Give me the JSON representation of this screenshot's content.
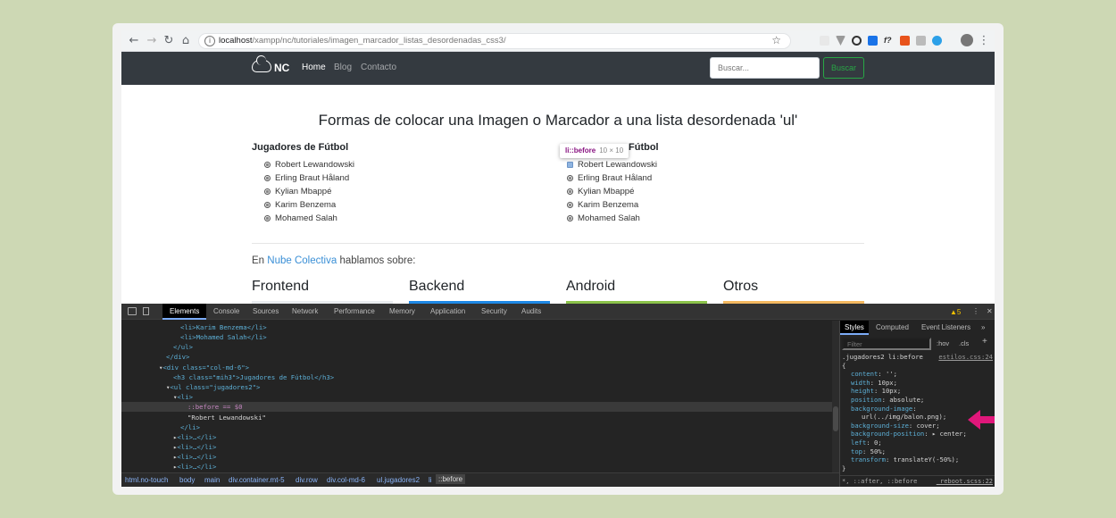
{
  "browser": {
    "url_host": "localhost",
    "url_path": "/xampp/nc/tutoriales/imagen_marcador_listas_desordenadas_css3/"
  },
  "navbar": {
    "brand": "NC",
    "links": [
      "Home",
      "Blog",
      "Contacto"
    ],
    "search_placeholder": "Buscar...",
    "search_button": "Buscar"
  },
  "page": {
    "title": "Formas de colocar una Imagen o Marcador a una lista desordenada 'ul'",
    "column1": {
      "heading": "Jugadores de Fútbol",
      "items": [
        "Robert Lewandowski",
        "Erling Braut Håland",
        "Kylian Mbappé",
        "Karim Benzema",
        "Mohamed Salah"
      ]
    },
    "column2": {
      "heading_visible": "Fútbol",
      "items": [
        "Robert Lewandowski",
        "Erling Braut Håland",
        "Kylian Mbappé",
        "Karim Benzema",
        "Mohamed Salah"
      ]
    },
    "tooltip": {
      "selector": "li::before",
      "size": "10 × 10"
    },
    "intro": {
      "prefix": "En ",
      "link": "Nube Colectiva",
      "suffix": " hablamos sobre:"
    },
    "categories": [
      {
        "name": "Frontend",
        "color": "#e9ecef"
      },
      {
        "name": "Backend",
        "color": "#1e88e5"
      },
      {
        "name": "Android",
        "color": "#8bc34a"
      },
      {
        "name": "Otros",
        "color": "#f4b860"
      }
    ]
  },
  "devtools": {
    "tabs": [
      "Elements",
      "Console",
      "Sources",
      "Network",
      "Performance",
      "Memory",
      "Application",
      "Security",
      "Audits"
    ],
    "warnings": "5",
    "dom_lines": [
      {
        "text": "<li>Karim Benzema</li>"
      },
      {
        "text": "<li>Mohamed Salah</li>"
      },
      {
        "text": "</ul>"
      },
      {
        "text": "</div>"
      },
      {
        "text": "<div class=\"col-md-6\">"
      },
      {
        "text": "<h3 class=\"mih3\">Jugadores de Fútbol</h3>"
      },
      {
        "text": "<ul class=\"jugadores2\">"
      },
      {
        "text": "<li>"
      },
      {
        "text": "::before == $0"
      },
      {
        "text": "\"Robert Lewandowski\""
      },
      {
        "text": "</li>"
      },
      {
        "text": "<li>…</li>"
      },
      {
        "text": "<li>…</li>"
      },
      {
        "text": "<li>…</li>"
      },
      {
        "text": "<li>…</li>"
      }
    ],
    "breadcrumbs": [
      "html.no-touch",
      "body",
      "main",
      "div.container.mt-5",
      "div.row",
      "div.col-md-6",
      "ul.jugadores2",
      "li",
      "::before"
    ],
    "styles_tabs": [
      "Styles",
      "Computed",
      "Event Listeners"
    ],
    "filter_placeholder": "Filter",
    "filter_options": [
      ":hov",
      ".cls",
      "+"
    ],
    "rule_selector": ".jugadores2 li:before",
    "rule_source": "estilos.css:24",
    "declarations": [
      {
        "prop": "content",
        "value": "'';"
      },
      {
        "prop": "width",
        "value": "10px;"
      },
      {
        "prop": "height",
        "value": "10px;"
      },
      {
        "prop": "position",
        "value": "absolute;"
      },
      {
        "prop": "background-image",
        "value": ""
      },
      {
        "prop": "",
        "value": "url(../img/balon.png);"
      },
      {
        "prop": "background-size",
        "value": "cover;"
      },
      {
        "prop": "background-position",
        "value": "▸ center;"
      },
      {
        "prop": "left",
        "value": "0;"
      },
      {
        "prop": "top",
        "value": "50%;"
      },
      {
        "prop": "transform",
        "value": "translateY(-50%);"
      }
    ],
    "footer_selector": "*, ::after, ::before",
    "footer_source": "_reboot.scss:22"
  },
  "colors": {
    "background": "#cdd8b4",
    "navbar": "#343a40",
    "accent_arrow": "#e0177a"
  }
}
